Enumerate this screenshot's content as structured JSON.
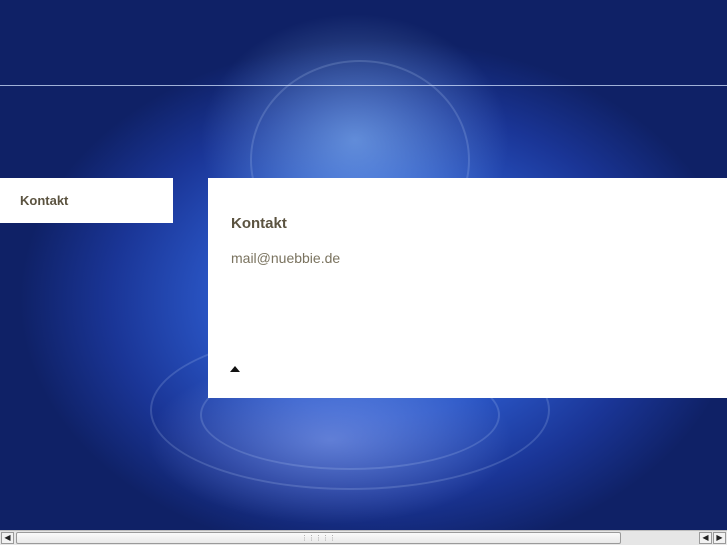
{
  "nav": {
    "items": [
      {
        "label": "Kontakt"
      }
    ]
  },
  "content": {
    "title": "Kontakt",
    "email": "mail@nuebbie.de",
    "back_to_top_icon": "triangle-up-icon"
  },
  "scrollbar": {
    "left_icon": "arrow-left-icon",
    "right_icon": "arrow-right-icon",
    "left_glyph": "◀",
    "right_glyph": "▶",
    "grip_glyph": "⋮⋮⋮⋮⋮"
  },
  "colors": {
    "text_primary": "#5b5340",
    "text_secondary": "#7a735f",
    "panel": "#ffffff",
    "background": "#2a56c6"
  }
}
